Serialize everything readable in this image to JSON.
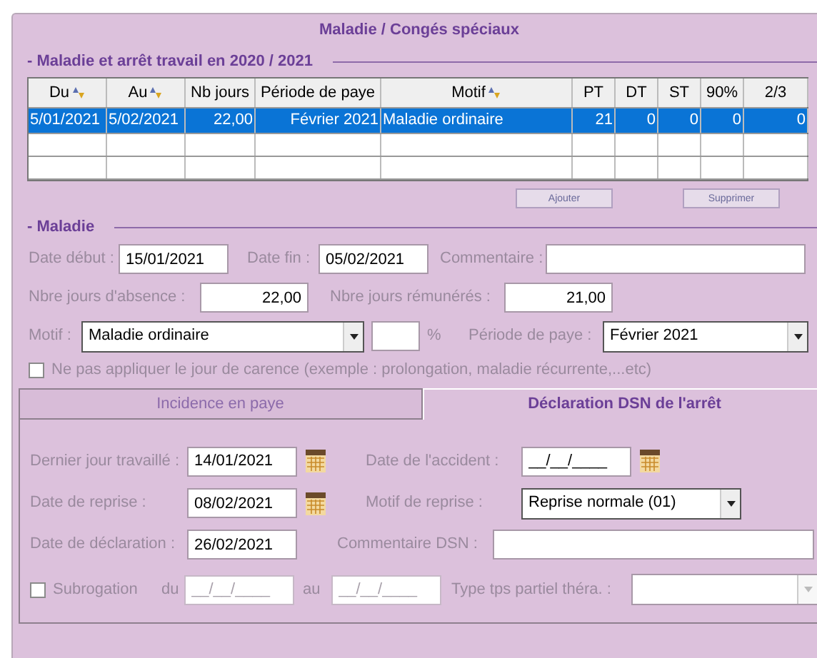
{
  "dialog": {
    "title": "Maladie / Congés spéciaux"
  },
  "history": {
    "title": "- Maladie et arrêt travail en 2020 / 2021",
    "table": {
      "columns": [
        {
          "label": "Du",
          "sortable": true
        },
        {
          "label": "Au",
          "sortable": true
        },
        {
          "label": "Nb jours",
          "sortable": false
        },
        {
          "label": "Période de paye",
          "sortable": false
        },
        {
          "label": "Motif",
          "sortable": true
        },
        {
          "label": "PT",
          "sortable": false
        },
        {
          "label": "DT",
          "sortable": false
        },
        {
          "label": "ST",
          "sortable": false
        },
        {
          "label": "90%",
          "sortable": false
        },
        {
          "label": "2/3",
          "sortable": false
        }
      ],
      "rows": [
        {
          "selected": true,
          "cells": [
            "5/01/2021",
            "5/02/2021",
            "22,00",
            "Février 2021",
            "Maladie ordinaire",
            "21",
            "0",
            "0",
            "0",
            "0"
          ]
        },
        {
          "selected": false
        },
        {
          "selected": false
        }
      ]
    },
    "buttons": [
      "Ajouter",
      "Supprimer"
    ]
  },
  "maladie": {
    "title": "- Maladie",
    "fields": [
      {
        "label": "Date début :",
        "kind": "input",
        "value": "15/01/2021"
      },
      {
        "label": "Date fin :",
        "kind": "input",
        "value": "05/02/2021"
      },
      {
        "label": "Commentaire :",
        "kind": "input"
      },
      {
        "label": "Nbre jours d'absence :",
        "kind": "number",
        "value": "22,00"
      },
      {
        "label": "Nbre jours rémunérés :",
        "kind": "number",
        "value": "21,00"
      },
      {
        "label": "Motif :",
        "kind": "select",
        "value": "Maladie ordinaire"
      },
      {
        "kind": "input",
        "unit": "%"
      },
      {
        "label": "Période de paye :",
        "kind": "select",
        "value": "Février 2021"
      }
    ],
    "carence": {
      "text": "Ne pas appliquer le jour de carence (exemple : prolongation, maladie récurrente,...etc)",
      "checked": false
    }
  },
  "tabs": [
    {
      "label": "Incidence en paye",
      "selected": false
    },
    {
      "label": "Déclaration DSN de l'arrêt",
      "selected": true
    }
  ],
  "dsn": {
    "fields": [
      {
        "label": "Dernier jour travaillé :",
        "kind": "input",
        "value": "14/01/2021",
        "calendar": true
      },
      {
        "label": "Date de l'accident :",
        "kind": "input",
        "value": "__/__/____",
        "calendar": true
      },
      {
        "label": "Date de reprise :",
        "kind": "input",
        "value": "08/02/2021",
        "calendar": true
      },
      {
        "label": "Motif de reprise :",
        "kind": "select",
        "value": "Reprise normale (01)"
      },
      {
        "label": "Date de déclaration :",
        "kind": "input",
        "value": "26/02/2021"
      },
      {
        "label": "Commentaire DSN :",
        "kind": "input"
      }
    ],
    "subrogation": {
      "text": "Subrogation",
      "checked": false,
      "from": {
        "label": "du",
        "placeholder": "__/__/____",
        "disabled": true
      },
      "to": {
        "label": "au",
        "placeholder": "__/__/____",
        "disabled": true
      }
    },
    "partial_time": {
      "label": "Type tps partiel théra. :",
      "kind": "select",
      "disabled": true
    }
  }
}
